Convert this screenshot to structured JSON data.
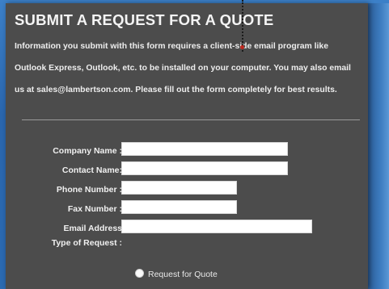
{
  "form": {
    "title": "SUBMIT A REQUEST FOR A QUOTE",
    "intro": "Information you submit with this form requires a client-side email program like Outlook Express, Outlook, etc. to be installed on your computer. You may also email us at sales@lambertson.com. Please fill out the form completely for best results.",
    "fields": [
      {
        "label": "Company Name :",
        "value": ""
      },
      {
        "label": "Contact Name:",
        "value": ""
      },
      {
        "label": "Phone Number :",
        "value": ""
      },
      {
        "label": "Fax Number :",
        "value": ""
      },
      {
        "label": "Email Address",
        "value": ""
      }
    ],
    "type_of_request_label": "Type of Request :",
    "request_options": [
      {
        "label": "Request for Quote",
        "selected": true
      }
    ]
  }
}
